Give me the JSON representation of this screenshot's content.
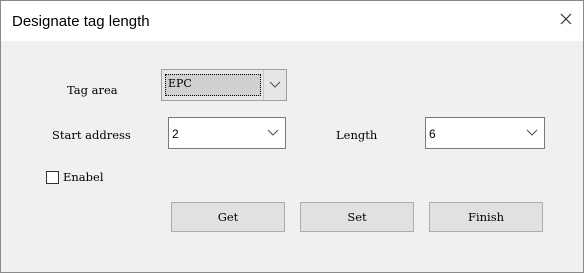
{
  "window": {
    "title": "Designate tag length"
  },
  "form": {
    "tag_area_label": "Tag area",
    "tag_area_value": "EPC",
    "start_address_label": "Start address",
    "start_address_value": "2",
    "length_label": "Length",
    "length_value": "6",
    "enable_label": "Enabel",
    "enable_checked": false
  },
  "buttons": {
    "get": "Get",
    "set": "Set",
    "finish": "Finish"
  },
  "icons": {
    "close": "close-icon",
    "dropdown": "chevron-down-icon"
  }
}
